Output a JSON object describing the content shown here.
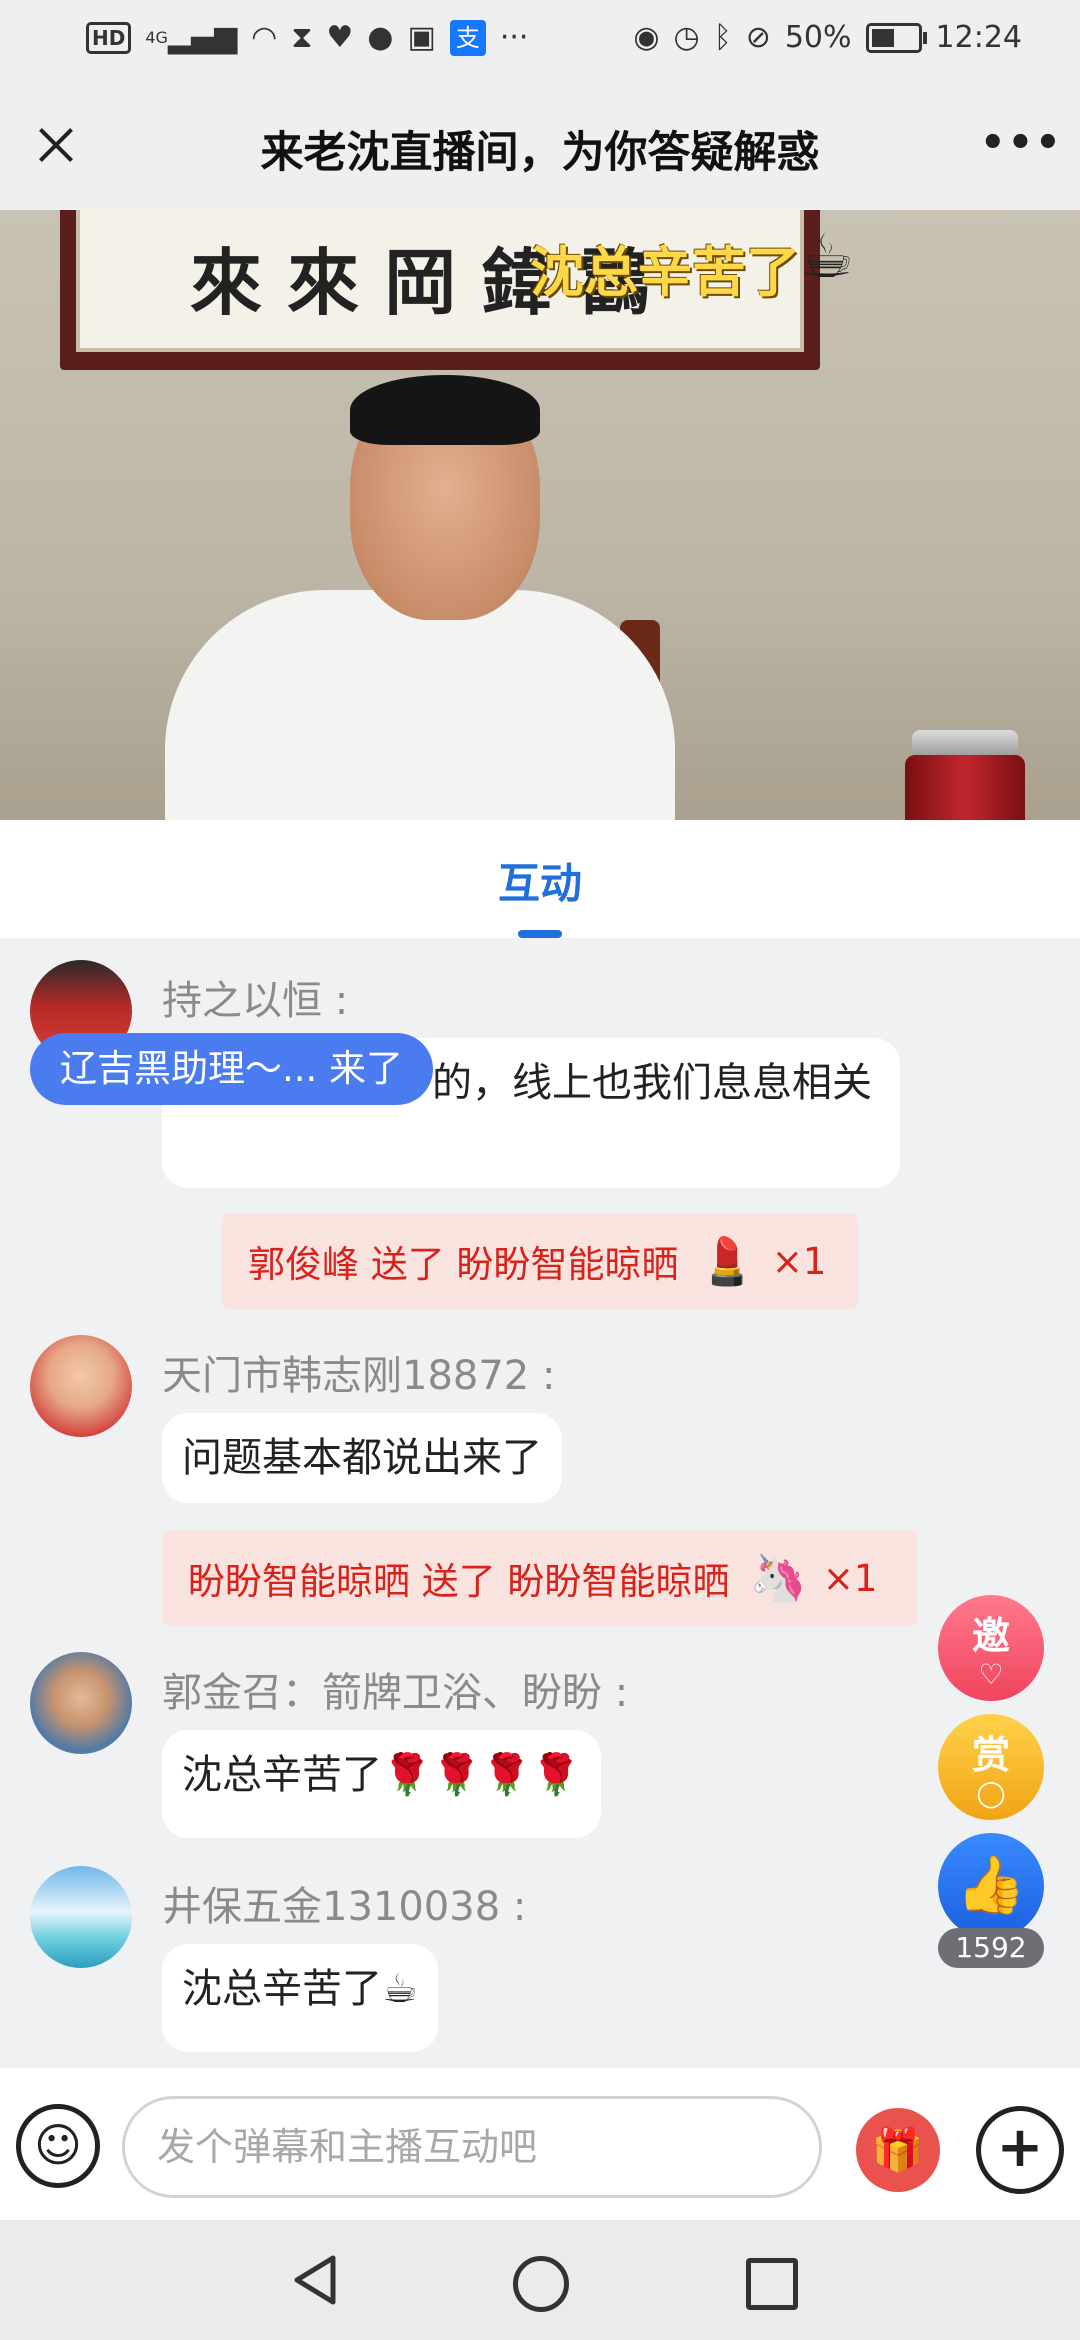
{
  "status_bar": {
    "network": "HD",
    "signal": "4G",
    "battery": "50%",
    "battery_level": 0.5,
    "time": "12:24",
    "more": "···"
  },
  "header": {
    "title": "来老沈直播间，为你答疑解惑",
    "more_label": "•••"
  },
  "video": {
    "overlay_text": "沈总辛苦了",
    "overlay_icon": "☕",
    "calligraphy": "來 來 岡 鍏 鸖"
  },
  "tabs": [
    {
      "label": "互动",
      "active": true
    }
  ],
  "join_notice": "辽吉黑助理～... 来了",
  "messages": [
    {
      "type": "chat",
      "name": "持之以恒 :",
      "text_hidden_prefix": "",
      "text": "的，线上也我们息息相关",
      "avatar_color": "#b52a26"
    },
    {
      "type": "gift",
      "text": "郭俊峰 送了 盼盼智能晾晒",
      "icon": "💄",
      "count": "×1"
    },
    {
      "type": "chat",
      "name": "天门市韩志刚18872 :",
      "text": "问题基本都说出来了",
      "avatar_color": "#e04a4a"
    },
    {
      "type": "gift",
      "text": "盼盼智能晾晒 送了 盼盼智能晾晒",
      "icon": "🦄",
      "count": "×1"
    },
    {
      "type": "chat",
      "name": "郭金召：箭牌卫浴、盼盼 :",
      "text": "沈总辛苦了🌹🌹🌹🌹",
      "avatar_color": "#5b8fc7"
    },
    {
      "type": "chat",
      "name": "井保五金1310038 :",
      "text": "沈总辛苦了☕",
      "avatar_color": "#3a9bd6"
    }
  ],
  "fabs": {
    "invite_label": "邀",
    "reward_label": "赏",
    "like_icon": "👍",
    "like_count": "1592"
  },
  "input": {
    "placeholder": "发个弹幕和主播互动吧",
    "emoji_icon": "☺",
    "gift_icon": "🎁",
    "plus_icon": "+"
  },
  "colors": {
    "accent": "#1f6fdc",
    "gift_text": "#d8231c",
    "gift_bg": "#f9e3df",
    "join_pill": "#4a7cf0"
  }
}
